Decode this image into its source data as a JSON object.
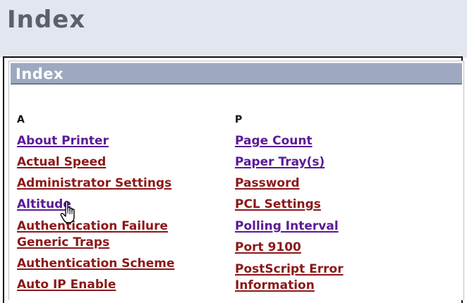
{
  "page": {
    "title": "Index"
  },
  "panel": {
    "title": "Index"
  },
  "index": {
    "col_a": {
      "letter": "A",
      "items": [
        {
          "lines": [
            "About Printer"
          ],
          "color": "#5a1a96"
        },
        {
          "lines": [
            "Actual Speed"
          ],
          "color": "#8c1818"
        },
        {
          "lines": [
            "Administrator Settings"
          ],
          "color": "#8c1818"
        },
        {
          "lines": [
            "Altitude"
          ],
          "color": "#5a1a96"
        },
        {
          "lines": [
            "Authentication Failure",
            "Generic Traps"
          ],
          "color": "#8c1818"
        },
        {
          "lines": [
            "Authentication Scheme"
          ],
          "color": "#8c1818"
        },
        {
          "lines": [
            "Auto IP Enable"
          ],
          "color": "#8c1818"
        }
      ]
    },
    "col_p": {
      "letter": "P",
      "items": [
        {
          "lines": [
            "Page Count"
          ],
          "color": "#5a1a96"
        },
        {
          "lines": [
            "Paper Tray(s)"
          ],
          "color": "#5a1a96"
        },
        {
          "lines": [
            "Password"
          ],
          "color": "#8c1818"
        },
        {
          "lines": [
            "PCL Settings"
          ],
          "color": "#8c1818"
        },
        {
          "lines": [
            "Polling Interval"
          ],
          "color": "#5a1a96"
        },
        {
          "lines": [
            "Port 9100"
          ],
          "color": "#8c1818"
        },
        {
          "lines": [
            "PostScript Error",
            "Information"
          ],
          "color": "#8c1818"
        }
      ]
    }
  },
  "colors": {
    "visited_link": "#5a1a96",
    "unvisited_link": "#8c1818",
    "panel_header": "#9ea8c0",
    "page_band": "#e2e6ee"
  },
  "cursor": {
    "icon": "hand-pointer-icon"
  }
}
